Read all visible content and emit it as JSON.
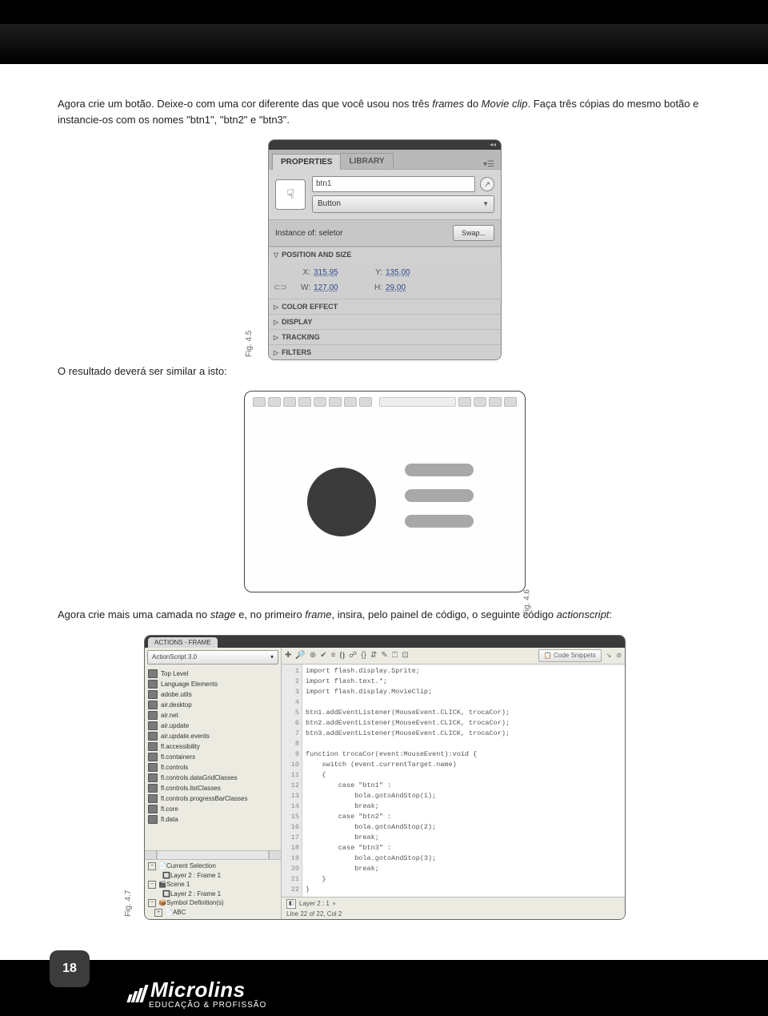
{
  "paragraph1_a": "Agora crie um botão. Deixe-o com uma cor diferente das que você usou nos três ",
  "paragraph1_b": "frames",
  "paragraph1_c": " do ",
  "paragraph1_d": "Movie clip",
  "paragraph1_e": ". Faça três cópias do mesmo botão e instancie-os com os nomes \"btn1\", \"btn2\" e \"btn3\".",
  "props": {
    "tab_properties": "PROPERTIES",
    "tab_library": "LIBRARY",
    "instance_name": "btn1",
    "type": "Button",
    "instance_of_label": "Instance of:",
    "instance_of_value": "seletor",
    "swap_label": "Swap...",
    "sec_pos": "POSITION AND SIZE",
    "x_label": "X:",
    "x_val": "315,95",
    "y_label": "Y:",
    "y_val": "135,00",
    "w_label": "W:",
    "w_val": "127,00",
    "h_label": "H:",
    "h_val": "29,00",
    "sec_color": "COLOR EFFECT",
    "sec_display": "DISPLAY",
    "sec_tracking": "TRACKING",
    "sec_filters": "FILTERS"
  },
  "fig45": "Fig. 4.5",
  "paragraph2": "O resultado deverá ser similar a isto:",
  "fig46": "Fig. 4.6",
  "paragraph3_a": "Agora crie mais uma camada no ",
  "paragraph3_b": "stage",
  "paragraph3_c": " e, no primeiro ",
  "paragraph3_d": "frame",
  "paragraph3_e": ", insira, pelo painel de código, o seguinte código ",
  "paragraph3_f": "actionscript",
  "paragraph3_g": ":",
  "actions": {
    "panel_tab": "ACTIONS - FRAME",
    "version": "ActionScript 3.0",
    "tree": [
      "Top Level",
      "Language Elements",
      "adobe.utils",
      "air.desktop",
      "air.net",
      "air.update",
      "air.update.events",
      "fl.accessibility",
      "fl.containers",
      "fl.controls",
      "fl.controls.dataGridClasses",
      "fl.controls.listClasses",
      "fl.controls.progressBarClasses",
      "fl.core",
      "fl.data"
    ],
    "current_selection": "Current Selection",
    "layer_frame_a": "Layer 2 : Frame 1",
    "scene": "Scene 1",
    "layer_frame_b": "Layer 2 : Frame 1",
    "symbol_def": "Symbol Definition(s)",
    "symbol_abc": "ABC",
    "snippets": "Code Snippets",
    "code_lines": [
      "import flash.display.Sprite;",
      "import flash.text.*;",
      "import flash.display.MovieClip;",
      "",
      "btn1.addEventListener(MouseEvent.CLICK, trocaCor);",
      "btn2.addEventListener(MouseEvent.CLICK, trocaCor);",
      "btn3.addEventListener(MouseEvent.CLICK, trocaCor);",
      "",
      "function trocaCor(event:MouseEvent):void {",
      "    switch (event.currentTarget.name)",
      "    {",
      "        case \"btn1\" :",
      "            bola.gotoAndStop(1);",
      "            break;",
      "        case \"btn2\" :",
      "            bola.gotoAndStop(2);",
      "            break;",
      "        case \"btn3\" :",
      "            bola.gotoAndStop(3);",
      "            break;",
      "    }",
      "}"
    ],
    "pin_label": "Layer 2 : 1",
    "status": "Line 22 of 22, Col 2"
  },
  "fig47": "Fig. 4.7",
  "page_number": "18",
  "brand_name": "Microlins",
  "brand_tag": "EDUCAÇÃO & PROFISSÃO"
}
